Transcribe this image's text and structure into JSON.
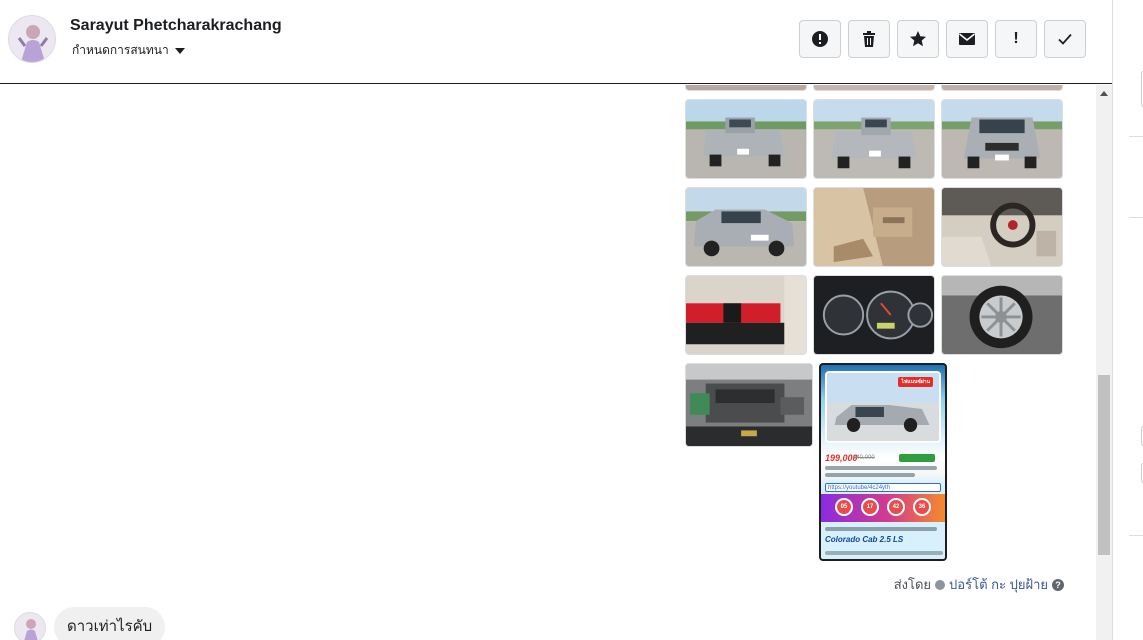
{
  "header": {
    "contact_name": "Sarayut Phetcharakrachang",
    "contact_subtitle": "กำหนดการสนทนา",
    "actions": [
      {
        "icon": "alert-circle-icon"
      },
      {
        "icon": "trash-icon"
      },
      {
        "icon": "star-icon"
      },
      {
        "icon": "envelope-icon"
      },
      {
        "icon": "exclamation-icon",
        "label": "!"
      },
      {
        "icon": "check-icon"
      }
    ]
  },
  "poster": {
    "badge": "ไฟแนนซ์ผ่าน",
    "price": "199,000",
    "old_price": "240,000",
    "url": "https://youtube/4c24yth",
    "circles": [
      "05",
      "17",
      "42",
      "36"
    ],
    "model": "Colorado Cab 2.5 LS"
  },
  "sent_by": {
    "prefix": "ส่งโดย",
    "sender": "ปอร์โต้ กะ ปุยฝ้าย"
  },
  "message": {
    "text": "ดาวเท่าไรคับ"
  },
  "colors": {
    "header_border": "#1c1e21",
    "bubble_bg": "#f1f0f0",
    "link": "#385898",
    "poster_price": "#e52d27"
  }
}
